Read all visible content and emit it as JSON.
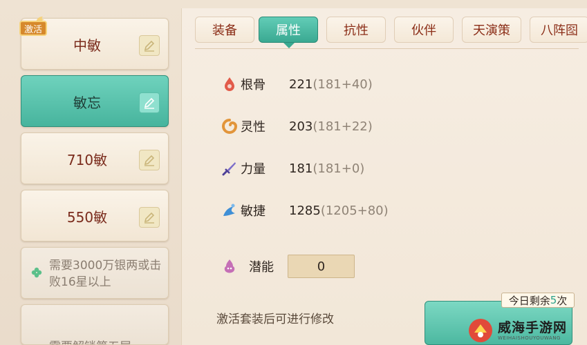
{
  "left": {
    "badge": "激活",
    "slots": [
      {
        "label": "中敏"
      },
      {
        "label": "敏忘"
      },
      {
        "label": "710敏"
      },
      {
        "label": "550敏"
      },
      {
        "label": "需要3000万银两或击败16星以上"
      },
      {
        "label": "需要解锁第五层"
      }
    ]
  },
  "tabs": [
    {
      "label": "装备"
    },
    {
      "label": "属性"
    },
    {
      "label": "抗性"
    },
    {
      "label": "伙伴"
    },
    {
      "label": "天演策"
    },
    {
      "label": "八阵图"
    }
  ],
  "stats": [
    {
      "name": "根骨",
      "value": "221",
      "breakdown": "(181+40)",
      "icon": "drop-icon",
      "color": "#e25b4a"
    },
    {
      "name": "灵性",
      "value": "203",
      "breakdown": "(181+22)",
      "icon": "swirl-icon",
      "color": "#e2953a"
    },
    {
      "name": "力量",
      "value": "181",
      "breakdown": "(181+0)",
      "icon": "sword-icon",
      "color": "#7b6cc9"
    },
    {
      "name": "敏捷",
      "value": "1285",
      "breakdown": "(1205+80)",
      "icon": "wind-icon",
      "color": "#3f8fd6"
    }
  ],
  "potential": {
    "label": "潜能",
    "value": "0",
    "icon": "spirit-icon",
    "color": "#c56fb6"
  },
  "footer": {
    "note": "激活套装后可进行修改",
    "remain_prefix": "今日剩余",
    "remain_count": "5",
    "remain_suffix": "次"
  },
  "watermark": {
    "main": "威海手游网",
    "sub": "WEIHAISHOUYOUWANG"
  },
  "colors": {
    "accent": "#47b49d",
    "tab_text": "#8b2d17",
    "slot_text": "#7a2b1c"
  }
}
